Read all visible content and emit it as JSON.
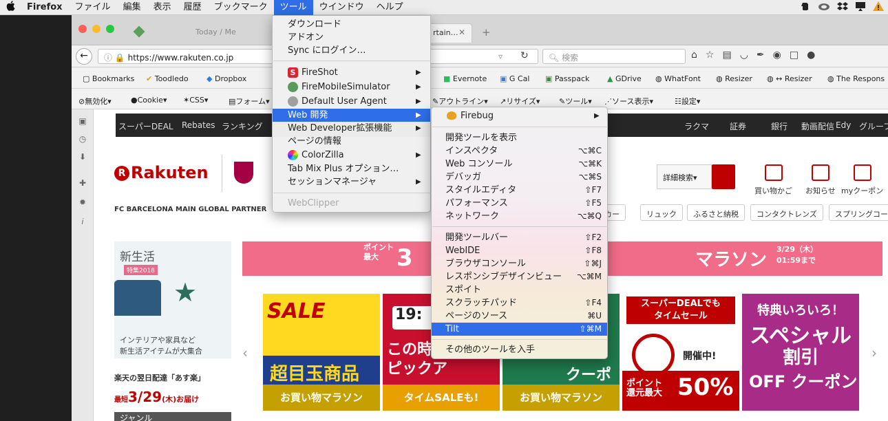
{
  "menubar": {
    "apple": "",
    "app": "Firefox",
    "items": [
      "ファイル",
      "編集",
      "表示",
      "履歴",
      "ブックマーク",
      "ツール",
      "ウインドウ",
      "ヘルプ"
    ],
    "active_index": 5
  },
  "window": {
    "tabs": [
      "Today / Me",
      "rtain…"
    ],
    "url": "https://www.rakuten.co.jp",
    "search_placeholder": "検索"
  },
  "bookmarks": [
    "Bookmarks",
    "Toodledo",
    "Dropbox",
    "Evernote",
    "G Cal",
    "Passpack",
    "GDrive",
    "WhatFont",
    "Resizer",
    "↔ Resizer",
    "The Respons"
  ],
  "webdev_toolbar": [
    "無効化▾",
    "Cookie▾",
    "CSS▾",
    "フォーム▾",
    "アウトライン▾",
    "リサイズ▾",
    "ツール▾",
    "ソース表示▾",
    "設定▾"
  ],
  "rakuten": {
    "nav": [
      "スーパーDEAL",
      "Rebates",
      "ランキング",
      "ラクマ",
      "証券",
      "銀行",
      "動画配信",
      "Edy",
      "グループ ⌄",
      "ヘルプ"
    ],
    "logo": "Rakuten",
    "partner": "FC BARCELONA MAIN GLOBAL PARTNER",
    "search_detail": "詳細検索▾",
    "tools": [
      "買い物かご",
      "お知らせ",
      "myクーポン"
    ],
    "chips": [
      "ーカー",
      "リュック",
      "ふるさと納税",
      "コンタクトレンズ",
      "スプリングコー"
    ],
    "banner_point": "ポイント\n最大",
    "banner_big": "3",
    "banner_marathon": "マラソン",
    "banner_date": "3/29（木）\n01:59まで",
    "newlife_title": "新生活",
    "newlife_tag": "特集2018",
    "newlife_desc": "インテリアや家具など\n新生活アイテムが大集合",
    "delivery_title": "楽天の翌日配達「あす楽」",
    "delivery_prefix": "最短",
    "delivery_date": "3/29",
    "delivery_suffix": "(木)お届け",
    "genre": "ジャンル",
    "card1_sale": "SALE",
    "card1_big": "超目玉商品",
    "card1_bottom": "お買い物マラソン",
    "card2_top": "19:",
    "card2_big": "この時\nピックア",
    "card2_bottom": "タイムSALEも!",
    "card4_big": "クーポン",
    "card4_bottom": "お買い物マラソン",
    "card5_h1": "スーパーDEALでも\nタイムセール",
    "card5_h2": "開催中!",
    "card5_point": "ポイント\n還元最大",
    "card5_pct": "50%",
    "card6_l1": "特典いろいろ！",
    "card6_l2": "スペシャル",
    "card6_l3": "割引",
    "card6_l4": "OFF クーポン"
  },
  "tools_menu": {
    "items": [
      {
        "label": "ダウンロード"
      },
      {
        "label": "アドオン"
      },
      {
        "label": "Sync にログイン…"
      },
      {
        "label": "FireShot",
        "submenu": true,
        "icon": "fireshot-icon"
      },
      {
        "label": "FireMobileSimulator",
        "submenu": true,
        "icon": "globe-icon"
      },
      {
        "label": "Default User Agent",
        "submenu": true,
        "icon": "user-agent-icon"
      },
      {
        "label": "Web 開発",
        "submenu": true,
        "highlighted": true
      },
      {
        "label": "Web Developer拡張機能",
        "submenu": true
      },
      {
        "label": "ページの情報"
      },
      {
        "label": "ColorZilla",
        "submenu": true,
        "icon": "colorzilla-icon"
      },
      {
        "label": "Tab Mix Plus オプション…"
      },
      {
        "label": "セッションマネージャ",
        "submenu": true
      },
      {
        "label": "WebClipper",
        "disabled": true
      }
    ]
  },
  "webdev_menu": {
    "items": [
      {
        "label": "Firebug",
        "submenu": true,
        "icon": "firebug-icon"
      },
      {
        "label": "開発ツールを表示",
        "shortcut": ""
      },
      {
        "label": "インスペクタ",
        "shortcut": "⌥⌘C"
      },
      {
        "label": "Web コンソール",
        "shortcut": "⌥⌘K"
      },
      {
        "label": "デバッガ",
        "shortcut": "⌥⌘S"
      },
      {
        "label": "スタイルエディタ",
        "shortcut": "⇧F7"
      },
      {
        "label": "パフォーマンス",
        "shortcut": "⇧F5"
      },
      {
        "label": "ネットワーク",
        "shortcut": "⌥⌘Q"
      },
      {
        "label": "開発ツールバー",
        "shortcut": "⇧F2"
      },
      {
        "label": "WebIDE",
        "shortcut": "⇧F8"
      },
      {
        "label": "ブラウザコンソール",
        "shortcut": "⇧⌘J"
      },
      {
        "label": "レスポンシブデザインビュー",
        "shortcut": "⌥⌘M"
      },
      {
        "label": "スポイト",
        "shortcut": ""
      },
      {
        "label": "スクラッチパッド",
        "shortcut": "⇧F4"
      },
      {
        "label": "ページのソース",
        "shortcut": "⌘U"
      },
      {
        "label": "Tilt",
        "shortcut": "⇧⌘M",
        "highlighted": true
      },
      {
        "label": "その他のツールを入手",
        "shortcut": ""
      }
    ]
  },
  "colors": {
    "highlight": "#2f6ee8",
    "rakuten_red": "#bf0000"
  }
}
